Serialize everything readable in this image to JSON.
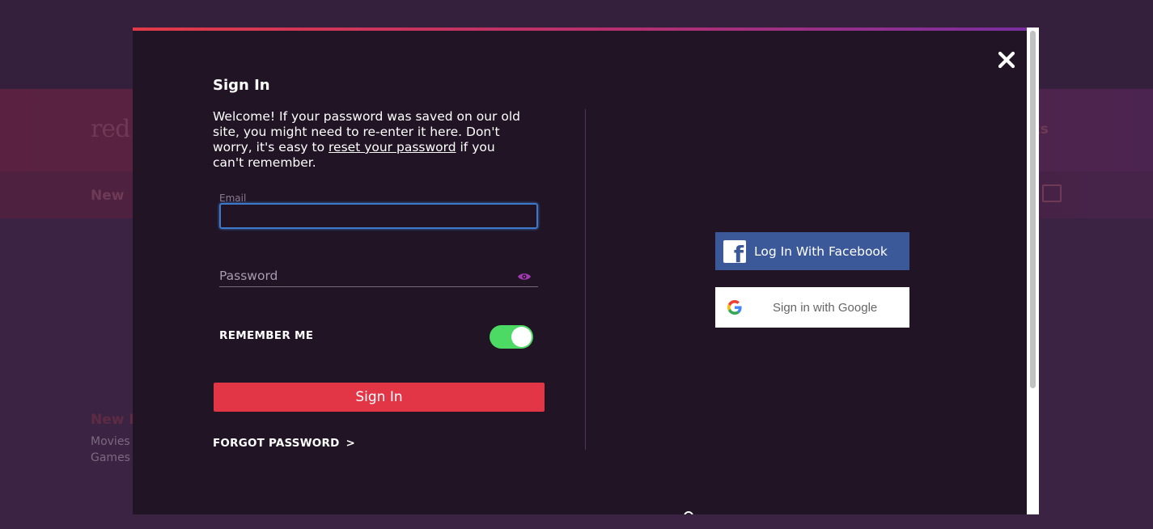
{
  "background": {
    "logo_text": "red",
    "nav_new": "New",
    "nav_works": "rks",
    "section_new": "New I",
    "link_movies": "Movies",
    "link_games": "Games"
  },
  "modal": {
    "title": "Sign In",
    "welcome_before": "Welcome! If your password was saved on our old site, you might need to re-enter it here. Don't worry, it's easy to ",
    "welcome_link": "reset your password",
    "welcome_after": " if you can't remember.",
    "email": {
      "label": "Email",
      "value": "",
      "placeholder": ""
    },
    "password": {
      "placeholder": "Password",
      "value": ""
    },
    "remember_me": {
      "label": "REMEMBER ME",
      "enabled": true
    },
    "sign_in_button": "Sign In",
    "forgot_password": "FORGOT PASSWORD",
    "forgot_chevron": ">",
    "facebook_button": "Log In With Facebook",
    "google_button": "Sign in with Google",
    "close_icon": "close-icon"
  },
  "colors": {
    "modal_bg": "#211425",
    "accent_red": "#e23545",
    "facebook_blue": "#3b5998",
    "toggle_green": "#4cd964",
    "focus_blue": "#3d78c9"
  }
}
